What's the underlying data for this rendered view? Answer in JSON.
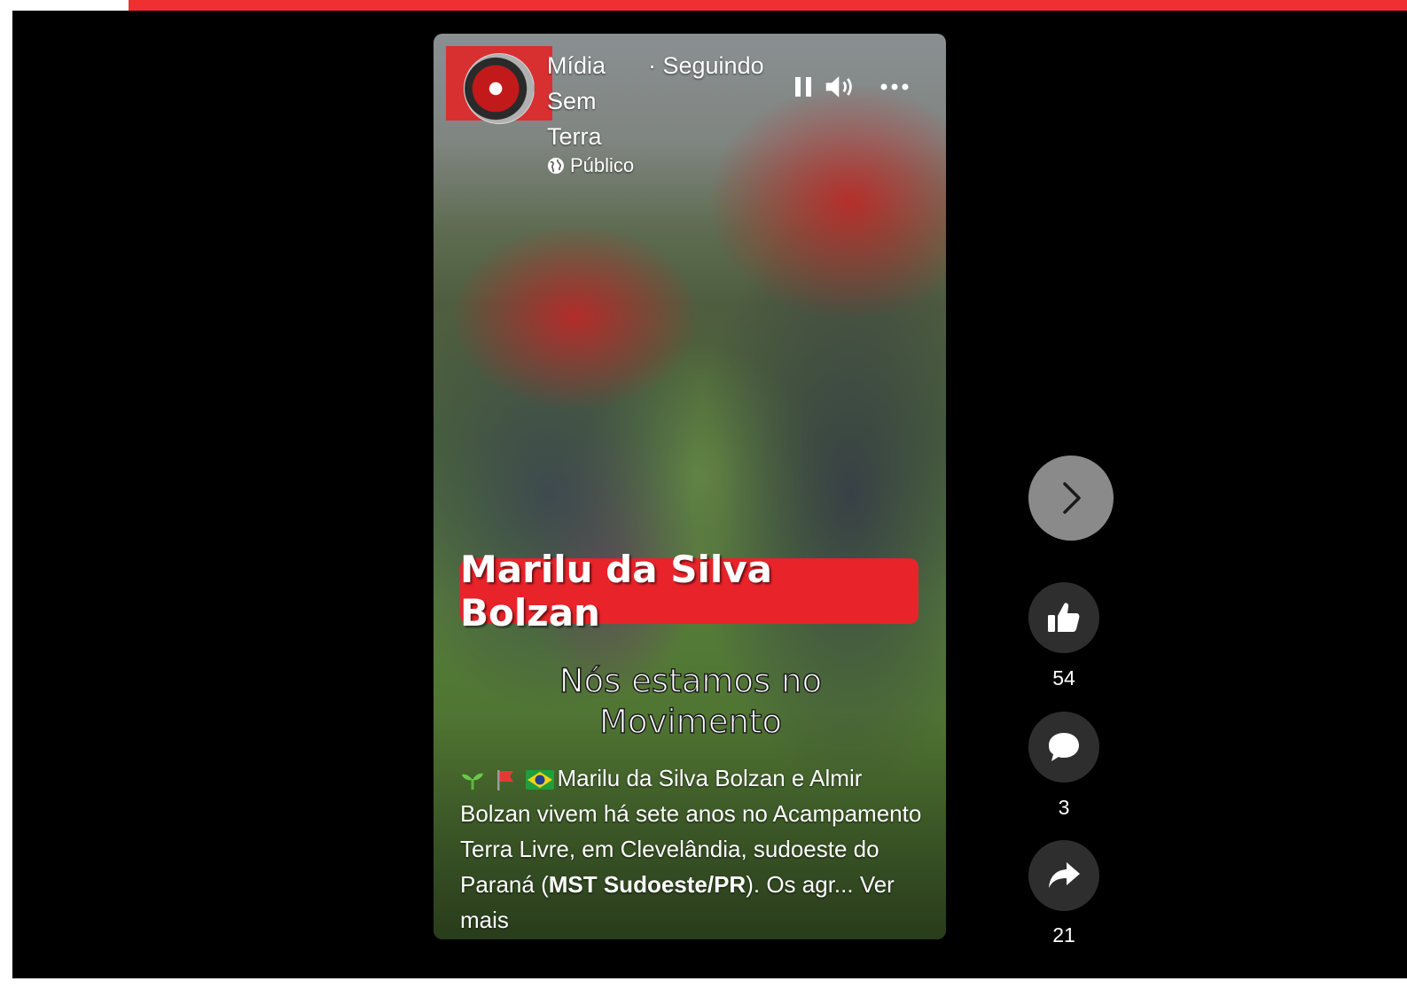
{
  "post": {
    "page_name": "Mídia Sem Terra",
    "following_label": "· Seguindo",
    "audience_label": "Público",
    "overlay_title": "Marilu da Silva Bolzan",
    "subtitle_lines": [
      "Nós estamos no",
      "Movimento"
    ],
    "caption": {
      "emoji": [
        "seedling",
        "red-flag",
        "brazil-flag"
      ],
      "text_1": "Marilu da Silva Bolzan e Almir Bolzan vivem há sete anos no Acampamento Terra Livre, em Clevelândia, sudoeste do Paraná (",
      "bold": "MST Sudoeste/PR",
      "text_2": "). Os agr... ",
      "see_more": "Ver mais"
    }
  },
  "controls": {
    "pause_icon": "pause-icon",
    "volume_icon": "volume-icon",
    "more_icon": "more-options-icon",
    "next_icon": "chevron-right-icon"
  },
  "actions": {
    "likes": "54",
    "comments": "3",
    "shares": "21"
  },
  "colors": {
    "top_bar": "#f03030",
    "title_badge": "#e8232a",
    "background": "#000000"
  }
}
